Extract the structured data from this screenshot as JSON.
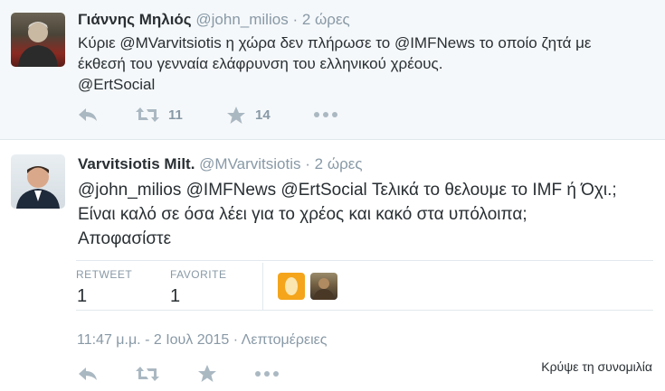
{
  "tweets": [
    {
      "name": "Γιάννης Μηλιός",
      "handle": "@john_milios",
      "dot": "·",
      "time": "2 ώρες",
      "text_parts": [
        "Κύριε ",
        "@MVarvitsiotis",
        " η χώρα δεν πλήρωσε το ",
        "@IMFNews",
        " το οποίο ζητά με έκθεσή του γενναία ελάφρυνση του ελληνικού χρέους.",
        "@ErtSocial"
      ],
      "retweet_count": "11",
      "favorite_count": "14"
    },
    {
      "name": "Varvitsiotis Milt.",
      "handle": "@MVarvitsiotis",
      "dot": "·",
      "time": "2 ώρες",
      "text_parts": [
        "@john_milios",
        " ",
        "@IMFNews",
        " ",
        "@ErtSocial",
        " Τελικά το θελουμε το IMF ή Όχι.; Είναι καλό σε όσα λέει για το χρέος και κακό στα υπόλοιπα; Αποφασίστε"
      ],
      "stats": {
        "retweet_label": "RETWEET",
        "retweet_value": "1",
        "favorite_label": "FAVORITE",
        "favorite_value": "1"
      },
      "timestamp": "11:47 μ.μ. - 2 Ιουλ 2015",
      "details_sep": "·",
      "details_link": "Λεπτομέρειες"
    }
  ],
  "hide_conversation": "Κρύψε τη συνομιλία",
  "colors": {
    "background_top": "#f5f8fa",
    "text": "#292f33",
    "muted": "#8899a6",
    "icon": "#aab8c2",
    "divider": "#e1e8ed"
  },
  "icons": [
    "reply-icon",
    "retweet-icon",
    "favorite-star-icon",
    "more-dots-icon"
  ]
}
